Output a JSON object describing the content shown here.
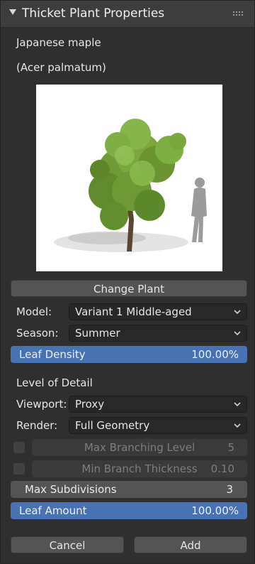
{
  "panel": {
    "title": "Thicket Plant Properties"
  },
  "plant": {
    "common_name": "Japanese maple",
    "latin_name": "(Acer palmatum)"
  },
  "buttons": {
    "change_plant": "Change Plant",
    "cancel": "Cancel",
    "add": "Add"
  },
  "model": {
    "label": "Model:",
    "value": "Variant 1 Middle-aged"
  },
  "season": {
    "label": "Season:",
    "value": "Summer"
  },
  "leaf_density": {
    "label": "Leaf Density",
    "value": "100.00%",
    "fraction": 1.0
  },
  "lod": {
    "heading": "Level of Detail",
    "viewport": {
      "label": "Viewport:",
      "value": "Proxy"
    },
    "render": {
      "label": "Render:",
      "value": "Full Geometry"
    }
  },
  "max_branching": {
    "label": "Max Branching Level",
    "value": "5",
    "checked": false,
    "enabled": false
  },
  "min_branch": {
    "label": "Min Branch Thickness",
    "value": "0.10",
    "checked": false,
    "enabled": false
  },
  "max_subdivisions": {
    "label": "Max Subdivisions",
    "value": "3"
  },
  "leaf_amount": {
    "label": "Leaf Amount",
    "value": "100.00%",
    "fraction": 1.0
  },
  "colors": {
    "accent": "#4772b3",
    "panel_bg": "#2f2f2f",
    "button": "#545454"
  },
  "icons": {
    "collapse": "triangle-down-icon",
    "drag": "grip-dots-icon",
    "dropdown": "chevron-down-icon"
  }
}
